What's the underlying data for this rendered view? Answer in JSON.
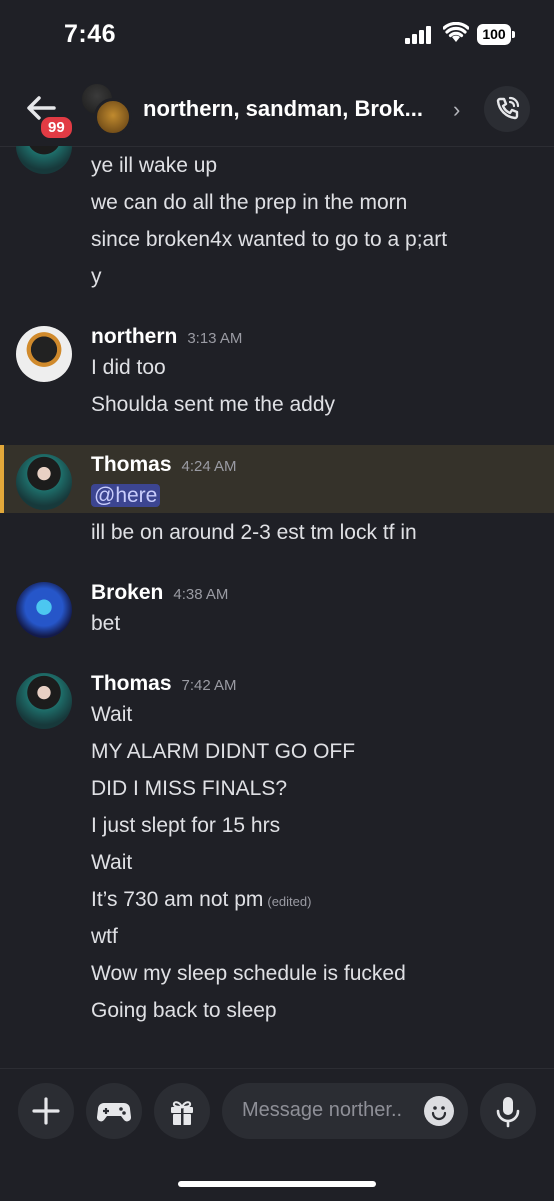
{
  "status_bar": {
    "time": "7:46",
    "battery": "100"
  },
  "header": {
    "badge_count": "99",
    "title": "northern, sandman, Brok...",
    "chevron": "›"
  },
  "messages": [
    {
      "lines": [
        "ye ill wake up",
        "we can do all the prep in the morn",
        "since broken4x wanted to go to a p;art",
        "y"
      ]
    },
    {
      "author": "northern",
      "time": "3:13 AM",
      "lines": [
        "I did too",
        "Shoulda sent me the addy"
      ]
    },
    {
      "author": "Thomas",
      "time": "4:24 AM",
      "mention": "@here",
      "lines": [
        "ill be on around 2-3 est tm lock tf in"
      ],
      "highlight_color": "#e2a83a"
    },
    {
      "author": "Broken",
      "time": "4:38 AM",
      "lines": [
        "bet"
      ]
    },
    {
      "author": "Thomas",
      "time": "7:42 AM",
      "lines": [
        "Wait",
        "MY ALARM DIDNT GO OFF",
        "DID I MISS FINALS?",
        "I just slept for 15 hrs",
        "Wait",
        "It’s 730 am not pm",
        "wtf",
        "Wow my sleep schedule is fucked",
        "Going back to sleep"
      ],
      "edited_label": "(edited)"
    }
  ],
  "composer": {
    "placeholder": "Message norther.."
  },
  "icons": {
    "back": "back-arrow-icon",
    "call": "phone-call-icon",
    "add": "plus-icon",
    "apps": "gamepad-icon",
    "gift": "gift-icon",
    "emoji": "emoji-icon",
    "mic": "microphone-icon"
  },
  "colors": {
    "background": "#1f2026",
    "badge": "#e23b44",
    "mention_bg": "#3c4591",
    "highlight_bg": "#35322a",
    "highlight_bar": "#e2a83a"
  }
}
